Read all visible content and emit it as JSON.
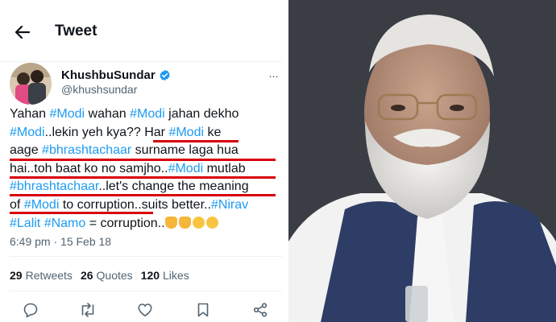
{
  "header": {
    "title": "Tweet"
  },
  "author": {
    "name": "KhushbuSundar",
    "handle": "@khushsundar"
  },
  "tweet": {
    "lines": [
      [
        {
          "t": "Yahan "
        },
        {
          "t": "#Modi",
          "tag": true
        },
        {
          "t": " wahan "
        },
        {
          "t": "#Modi",
          "tag": true
        },
        {
          "t": " jahan dekho"
        }
      ],
      [
        {
          "t": "#Modi",
          "tag": true
        },
        {
          "t": "..lekin yeh kya?? Har "
        },
        {
          "t": "#Modi",
          "tag": true
        },
        {
          "t": " ke"
        }
      ],
      [
        {
          "t": "aage "
        },
        {
          "t": "#bhrashtachaar",
          "tag": true
        },
        {
          "t": " surname laga hua"
        }
      ],
      [
        {
          "t": "hai..toh baat ko no samjho.."
        },
        {
          "t": "#Modi",
          "tag": true
        },
        {
          "t": " mutlab"
        }
      ],
      [
        {
          "t": "#bhrashtachaar",
          "tag": true
        },
        {
          "t": "..let's change the meaning"
        }
      ],
      [
        {
          "t": "of "
        },
        {
          "t": "#Modi",
          "tag": true
        },
        {
          "t": " to corruption..suits better.."
        },
        {
          "t": "#Nirav",
          "tag": true
        }
      ],
      [
        {
          "t": "#Lalit",
          "tag": true
        },
        {
          "t": " "
        },
        {
          "t": "#Namo",
          "tag": true
        },
        {
          "t": " = corruption.."
        }
      ]
    ]
  },
  "timestamp": "6:49 pm · 15 Feb 18",
  "stats": {
    "retweets_count": "29",
    "retweets_label": "Retweets",
    "quotes_count": "26",
    "quotes_label": "Quotes",
    "likes_count": "120",
    "likes_label": "Likes"
  },
  "colors": {
    "link": "#1d9bf0",
    "underline": "#d8000c",
    "verified": "#1d9bf0"
  },
  "icons": [
    "back-arrow-icon",
    "verified-badge-icon",
    "more-icon",
    "reply-icon",
    "retweet-icon",
    "like-icon",
    "bookmark-icon",
    "share-icon"
  ]
}
